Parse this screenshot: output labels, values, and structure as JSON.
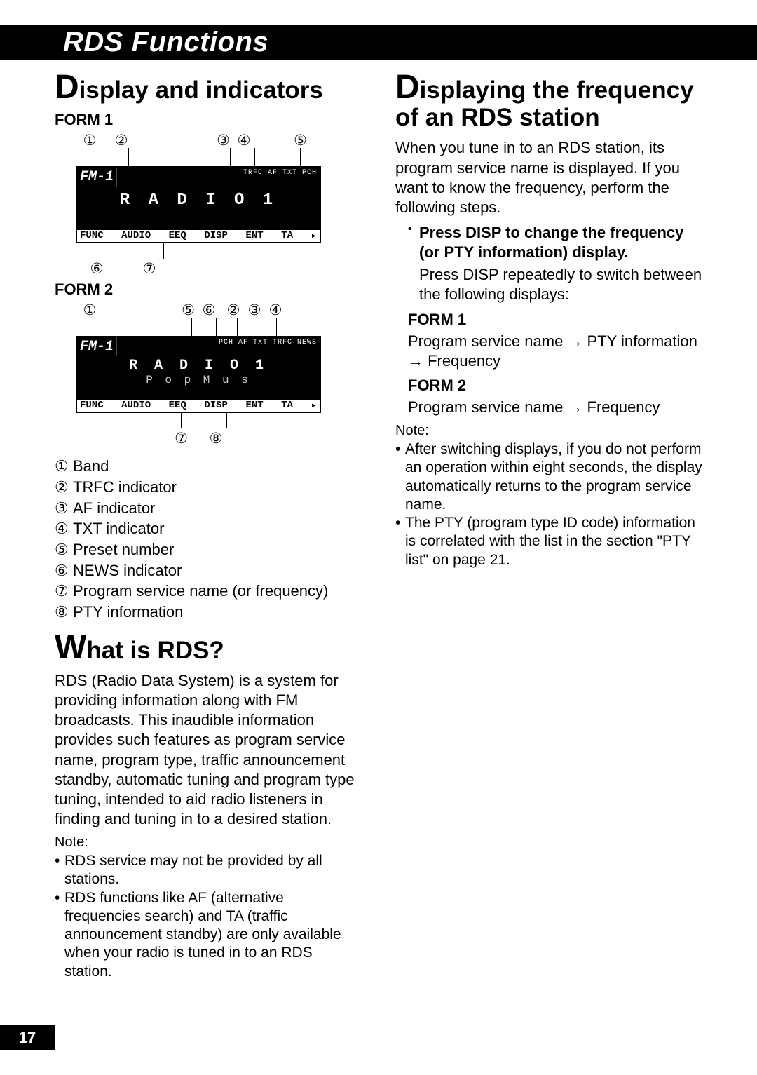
{
  "section_title": "RDS Functions",
  "page_number": "17",
  "left": {
    "heading": "Display and indicators",
    "form1_label": "FORM 1",
    "form2_label": "FORM 2",
    "callouts_top_f1": [
      "①",
      "②",
      "③",
      "④",
      "⑤"
    ],
    "callouts_bot_f1": [
      "⑥",
      "⑦"
    ],
    "callouts_top_f2": [
      "①",
      "⑤",
      "⑥",
      "②",
      "③",
      "④"
    ],
    "callouts_bot_f2": [
      "⑦",
      "⑧"
    ],
    "lcd1": {
      "band": "FM-1",
      "main": "R A D I O   1",
      "bot": [
        "FUNC",
        "AUDIO",
        "EEQ",
        "DISP",
        "ENT",
        "TA",
        "▸"
      ],
      "icons": "TRFC  AF  TXT  PCH"
    },
    "lcd2": {
      "band": "FM-1",
      "main": "R A D I O   1",
      "sub": "P o p    M u s",
      "bot": [
        "FUNC",
        "AUDIO",
        "EEQ",
        "DISP",
        "ENT",
        "TA",
        "▸"
      ],
      "icons": "PCH  AF TXT  TRFC NEWS"
    },
    "legend": [
      {
        "n": "①",
        "t": "Band"
      },
      {
        "n": "②",
        "t": "TRFC indicator"
      },
      {
        "n": "③",
        "t": "AF indicator"
      },
      {
        "n": "④",
        "t": "TXT indicator"
      },
      {
        "n": "⑤",
        "t": "Preset number"
      },
      {
        "n": "⑥",
        "t": "NEWS indicator"
      },
      {
        "n": "⑦",
        "t": "Program service name (or frequency)"
      },
      {
        "n": "⑧",
        "t": "PTY information"
      }
    ],
    "what_heading": "What is RDS?",
    "what_body": "RDS (Radio Data System) is a system for providing information along with FM broadcasts. This inaudible information provides such features as program service name, program type, traffic announcement standby, automatic tuning and program type tuning, intended to aid radio listeners in finding and tuning in to a desired station.",
    "note_label": "Note:",
    "notes": [
      "RDS service may not be provided by all stations.",
      "RDS functions like AF (alternative frequencies search) and TA (traffic announcement standby) are only available when your radio is tuned in to an RDS station."
    ]
  },
  "right": {
    "heading": "Displaying the frequency of an RDS station",
    "intro": "When you tune in to an RDS station, its program service name is displayed. If you want to know the frequency, perform the following steps.",
    "instr_bold": "Press DISP to change the frequency (or PTY information) display.",
    "instr_body": "Press DISP repeatedly to switch between the following displays:",
    "form1_label": "FORM 1",
    "form1_seq": "Program service name → PTY information → Frequency",
    "form2_label": "FORM 2",
    "form2_seq": "Program service name → Frequency",
    "note_label": "Note:",
    "notes": [
      "After switching displays, if you do not perform an operation within eight seconds, the display automatically returns to the program service name.",
      "The PTY (program type ID code) information is correlated with the list in the section \"PTY list\" on page 21."
    ]
  }
}
